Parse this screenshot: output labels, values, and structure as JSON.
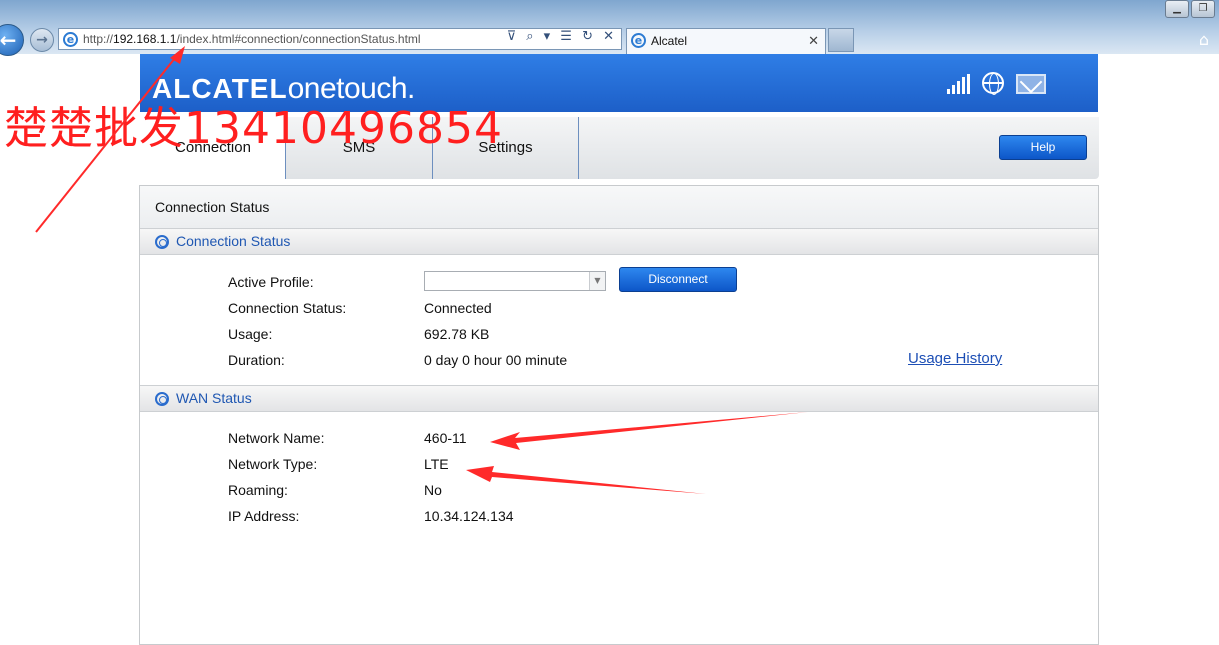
{
  "browser": {
    "url_prefix": "http://",
    "url_host": "192.168.1.1",
    "url_path": "/index.html#connection/connectionStatus.html",
    "tab_title": "Alcatel",
    "back_glyph": "←",
    "forward_glyph": "→",
    "tab_close_glyph": "✕",
    "address_tools_glyphs": "⊽ ⌕ ▾ ☰ ↻ ✕",
    "home_glyph": "⌂",
    "minimize_glyph": "▁",
    "restore_glyph": "❐"
  },
  "header": {
    "logo_part1": "ALCATEL",
    "logo_part2": "onetouch.",
    "icons": [
      "signal-icon",
      "globe-icon",
      "mail-icon"
    ]
  },
  "nav": {
    "tabs": [
      {
        "label": "Connection",
        "active": true
      },
      {
        "label": "SMS",
        "active": false
      },
      {
        "label": "Settings",
        "active": false
      }
    ],
    "help_label": "Help"
  },
  "panel": {
    "title": "Connection Status",
    "connection_section": {
      "header": "Connection Status",
      "active_profile_label": "Active Profile:",
      "active_profile_value": "",
      "disconnect_label": "Disconnect",
      "status_label": "Connection Status:",
      "status_value": "Connected",
      "usage_label": "Usage:",
      "usage_value": "692.78 KB",
      "duration_label": "Duration:",
      "duration_value": "0 day 0 hour 00 minute",
      "usage_history_link": "Usage History"
    },
    "wan_section": {
      "header": "WAN Status",
      "network_name_label": "Network Name:",
      "network_name_value": "460-11",
      "network_type_label": "Network Type:",
      "network_type_value": "LTE",
      "roaming_label": "Roaming:",
      "roaming_value": "No",
      "ip_label": "IP Address:",
      "ip_value": "10.34.124.134"
    }
  },
  "overlay": {
    "watermark_text": "楚楚批发13410496854",
    "color": "#ff1f1f"
  },
  "colors": {
    "header_blue": "#2f7ee6",
    "button_blue": "#0d56c8",
    "link_blue": "#1d4fb5",
    "section_text": "#1f57b2"
  }
}
